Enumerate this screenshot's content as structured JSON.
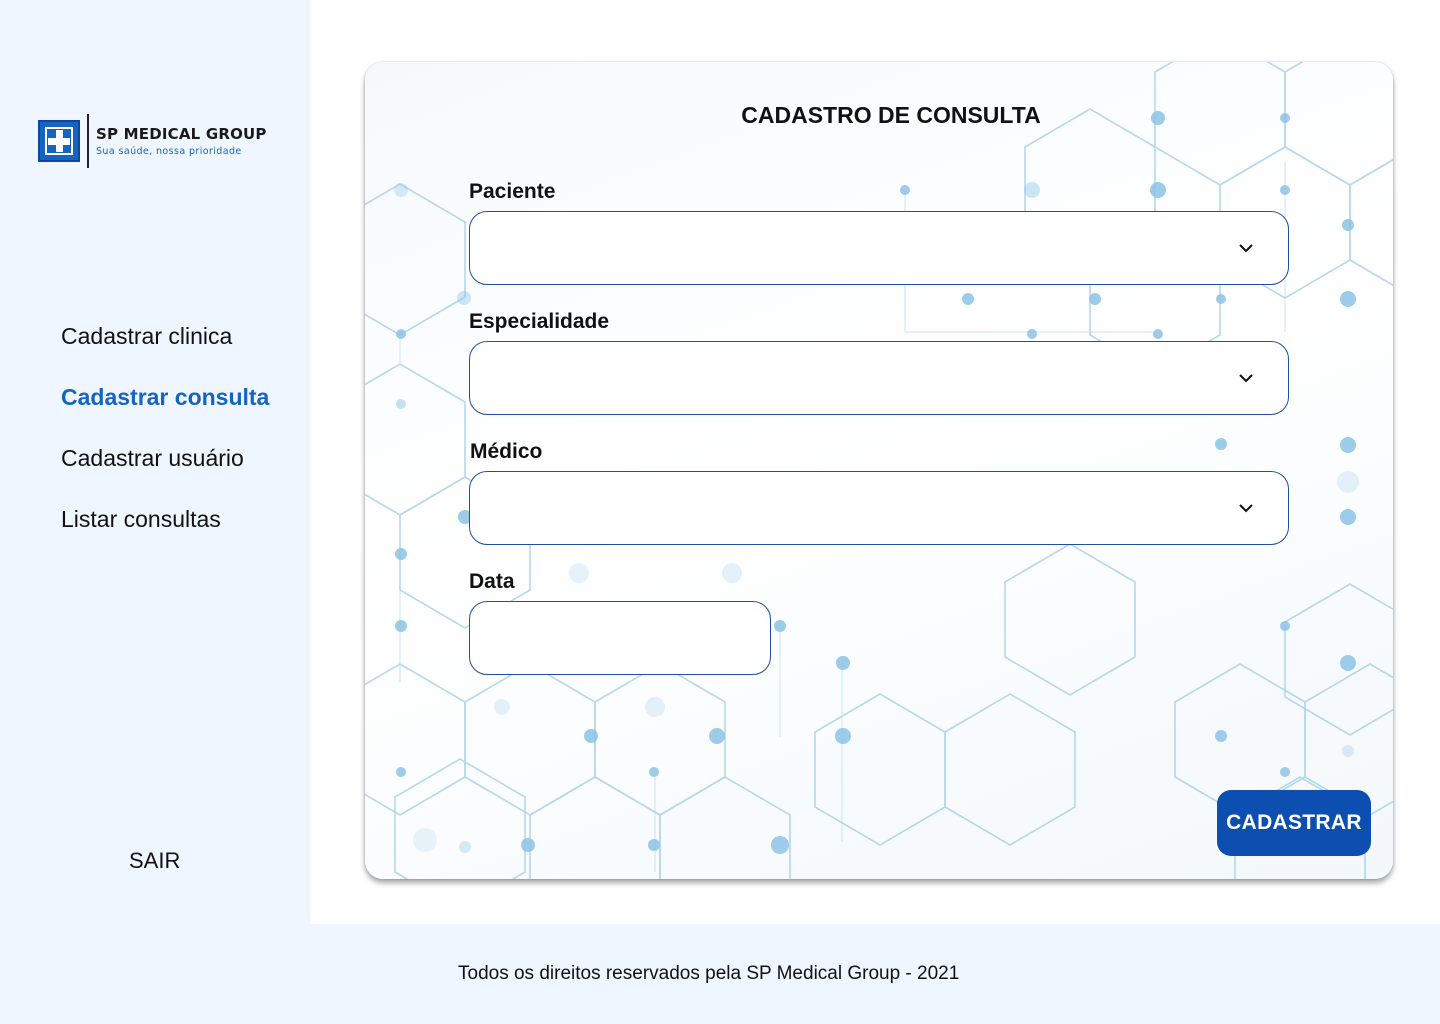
{
  "logo": {
    "brand": "SP MEDICAL GROUP",
    "tagline": "Sua saúde, nossa prioridade"
  },
  "sidebar": {
    "items": [
      {
        "label": "Cadastrar clinica",
        "active": false
      },
      {
        "label": "Cadastrar consulta",
        "active": true
      },
      {
        "label": "Cadastrar usuário",
        "active": false
      },
      {
        "label": "Listar consultas",
        "active": false
      }
    ],
    "logout_label": "SAIR"
  },
  "form": {
    "title": "CADASTRO DE CONSULTA",
    "fields": {
      "paciente": {
        "label": "Paciente",
        "value": ""
      },
      "especialidade": {
        "label": "Especialidade",
        "value": ""
      },
      "medico": {
        "label": "Médico",
        "value": ""
      },
      "data": {
        "label": "Data",
        "value": ""
      }
    },
    "submit_label": "CADASTRAR"
  },
  "footer": {
    "text": "Todos os direitos reservados pela SP Medical Group - 2021"
  },
  "colors": {
    "accent": "#1565c0",
    "button": "#0d4fb0",
    "sidebar_bg": "#eff6ff",
    "input_border": "#1e4fa3"
  },
  "icons": {
    "dropdown": "chevron-down-icon",
    "logo": "medical-cross-icon"
  }
}
